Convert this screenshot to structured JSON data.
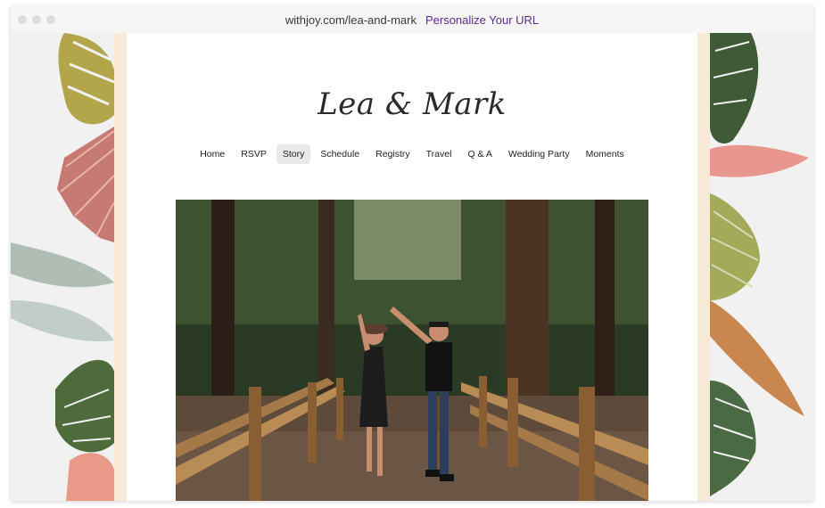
{
  "browser": {
    "url": "withjoy.com/lea-and-mark",
    "personalize_link": "Personalize Your URL"
  },
  "site": {
    "couple_names": "Lea & Mark",
    "nav": [
      {
        "label": "Home"
      },
      {
        "label": "RSVP"
      },
      {
        "label": "Story",
        "active": true
      },
      {
        "label": "Schedule"
      },
      {
        "label": "Registry"
      },
      {
        "label": "Travel"
      },
      {
        "label": "Q & A"
      },
      {
        "label": "Wedding Party"
      },
      {
        "label": "Moments"
      }
    ]
  },
  "colors": {
    "accent_link": "#5a2d91",
    "active_tab_bg": "#e9e9e9"
  },
  "images": {
    "hero": "couple-dancing-forest-photo",
    "decor_left": "tropical-foliage-left",
    "decor_right": "tropical-foliage-right"
  }
}
